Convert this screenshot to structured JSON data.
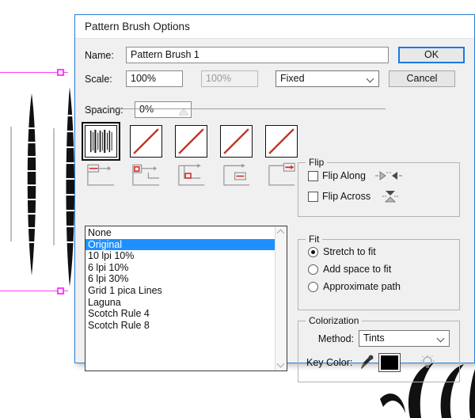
{
  "dialog": {
    "title": "Pattern Brush Options",
    "name_label": "Name:",
    "name_value": "Pattern Brush 1",
    "scale_label": "Scale:",
    "scale_value": "100%",
    "scale_secondary_value": "100%",
    "scale_mode": "Fixed",
    "spacing_label": "Spacing:",
    "spacing_value": "0%",
    "ok_label": "OK",
    "cancel_label": "Cancel"
  },
  "tiles": [
    {
      "name": "side-tile",
      "icon": "hatch-pattern-swatch",
      "selected": true
    },
    {
      "name": "outer-corner-tile",
      "icon": "diagonal-line-swatch",
      "selected": false
    },
    {
      "name": "inner-corner-tile",
      "icon": "diagonal-line-swatch",
      "selected": false
    },
    {
      "name": "start-tile",
      "icon": "diagonal-line-swatch",
      "selected": false
    },
    {
      "name": "end-tile",
      "icon": "diagonal-line-swatch",
      "selected": false
    }
  ],
  "flip": {
    "legend": "Flip",
    "along_label": "Flip Along",
    "along_checked": false,
    "across_label": "Flip Across",
    "across_checked": false
  },
  "fit": {
    "legend": "Fit",
    "options": [
      {
        "label": "Stretch to fit",
        "selected": true
      },
      {
        "label": "Add space to fit",
        "selected": false
      },
      {
        "label": "Approximate path",
        "selected": false
      }
    ]
  },
  "colorization": {
    "legend": "Colorization",
    "method_label": "Method:",
    "method_value": "Tints",
    "key_color_label": "Key Color:",
    "key_color_hex": "#000000"
  },
  "pattern_list": {
    "items": [
      {
        "label": "None",
        "selected": false
      },
      {
        "label": "Original",
        "selected": true
      },
      {
        "label": "10 lpi 10%",
        "selected": false
      },
      {
        "label": "6 lpi 10%",
        "selected": false
      },
      {
        "label": "6 lpi 30%",
        "selected": false
      },
      {
        "label": "Grid 1 pica Lines",
        "selected": false
      },
      {
        "label": "Laguna",
        "selected": false
      },
      {
        "label": "Scotch Rule 4",
        "selected": false
      },
      {
        "label": "Scotch Rule 8",
        "selected": false
      }
    ]
  },
  "colors": {
    "accent": "#1e90ff",
    "dialog_border": "#2a7fd4",
    "dialog_bg": "#f0f0f0",
    "tile_line": "#c0392b",
    "guide": "#ff40ff"
  }
}
